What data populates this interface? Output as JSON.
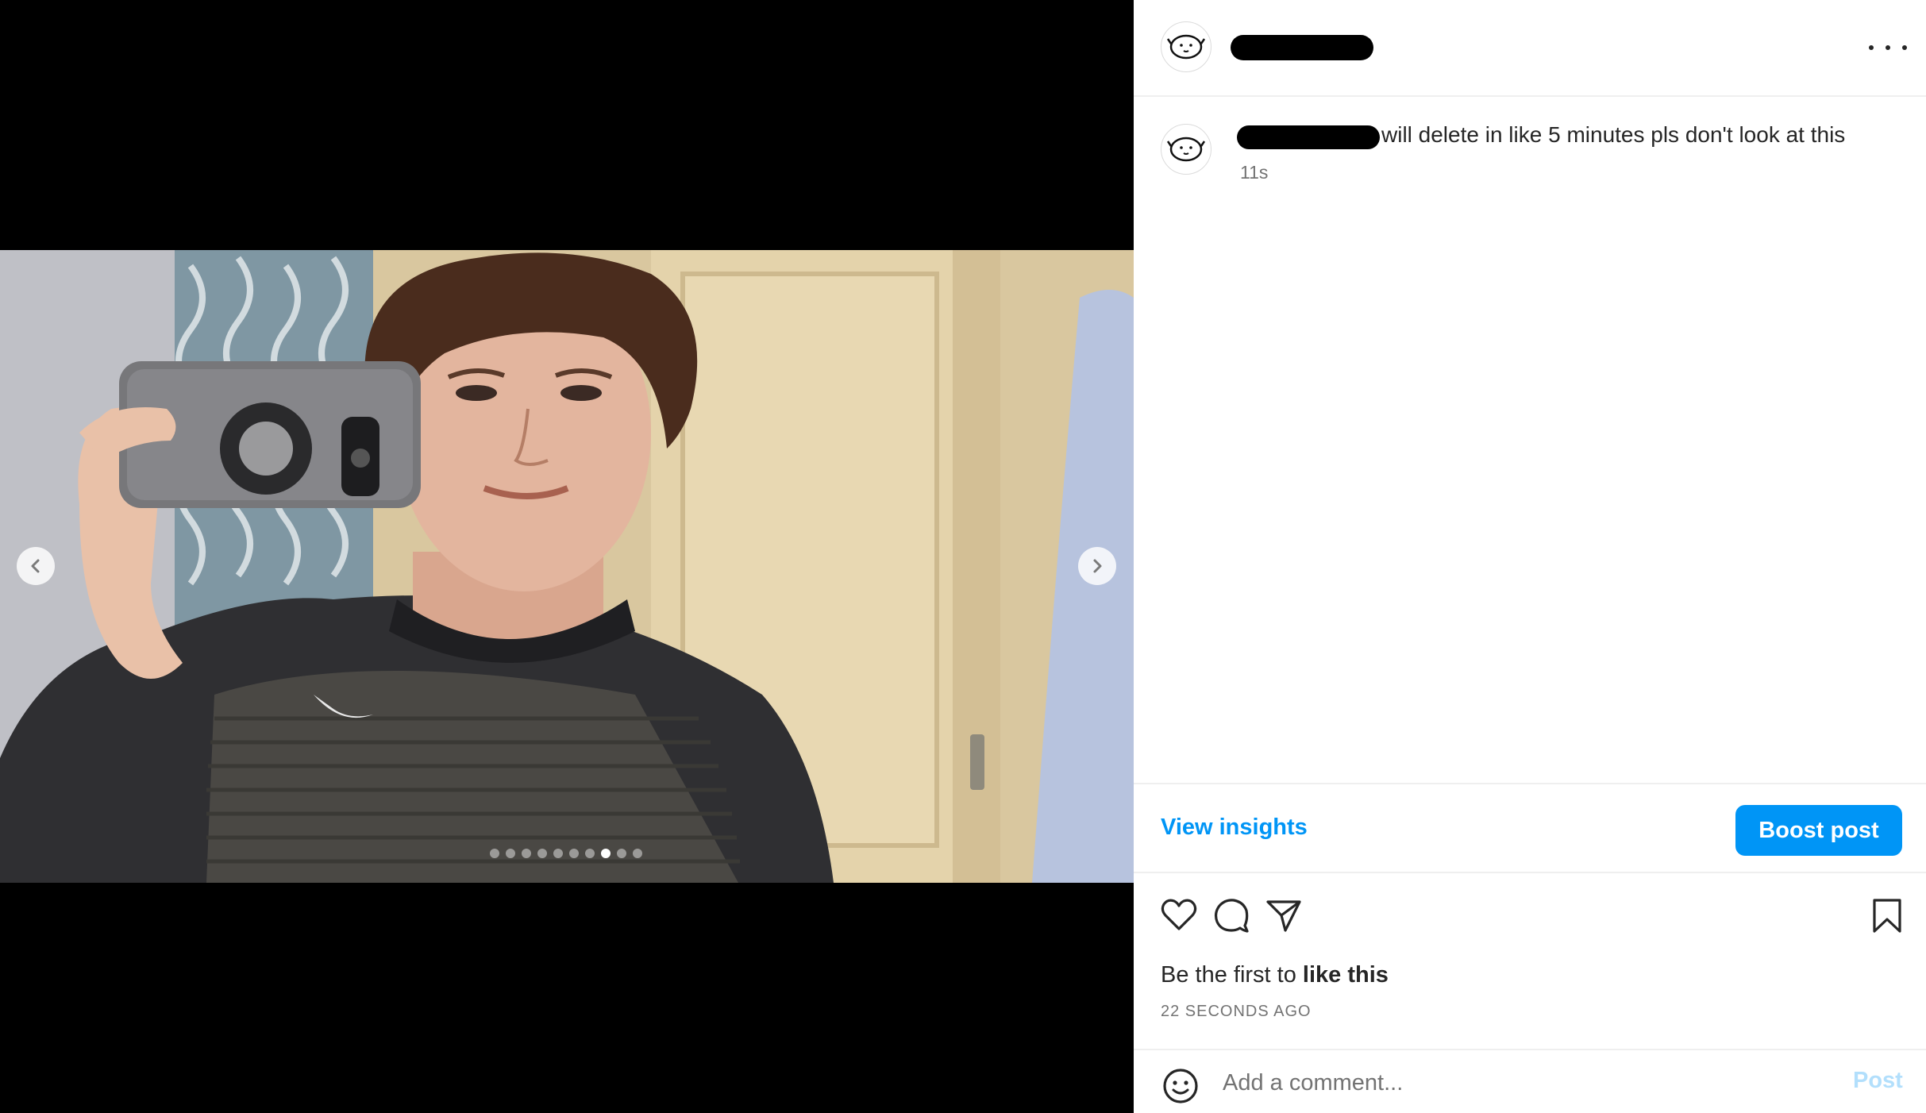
{
  "post": {
    "time_short": "11s",
    "caption": "will delete in like 5 minutes pls don't look at this",
    "media": {
      "alt": "Mirror selfie of a person holding a grey phone",
      "slide_count": 10,
      "active_slide": 7
    }
  },
  "insights": {
    "view_label": "View insights",
    "boost_label": "Boost post"
  },
  "engagement": {
    "likes_prefix": "Be the first to ",
    "likes_link": "like this",
    "time_ago": "22 SECONDS AGO"
  },
  "comment": {
    "placeholder": "Add a comment...",
    "post_label": "Post"
  },
  "colors": {
    "accent": "#0095f6",
    "accent_disabled": "#b2dffc",
    "text": "#262626",
    "muted": "#737373"
  },
  "icons": [
    "chevron-left-icon",
    "chevron-right-icon",
    "more-icon",
    "heart-icon",
    "comment-icon",
    "share-icon",
    "bookmark-icon",
    "emoji-icon"
  ]
}
